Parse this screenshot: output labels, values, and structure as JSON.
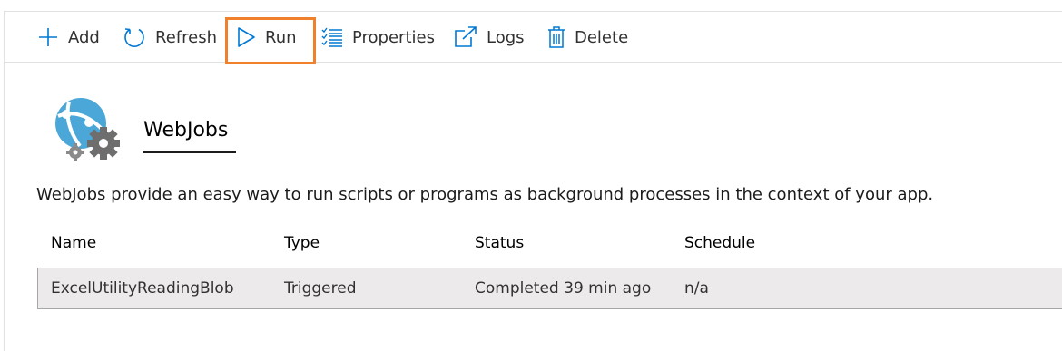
{
  "toolbar": {
    "add_label": "Add",
    "refresh_label": "Refresh",
    "run_label": "Run",
    "properties_label": "Properties",
    "logs_label": "Logs",
    "delete_label": "Delete"
  },
  "icons": {
    "add": "plus-icon",
    "refresh": "refresh-icon",
    "run": "play-icon",
    "properties": "list-icon",
    "logs": "external-link-icon",
    "delete": "trash-icon",
    "logo": "webjobs-logo-icon"
  },
  "colors": {
    "accent": "#0078d4",
    "highlight": "#f0802b",
    "row_background": "#eceaea"
  },
  "header": {
    "title": "WebJobs",
    "description": "WebJobs provide an easy way to run scripts or programs as background processes in the context of your app."
  },
  "table": {
    "columns": [
      "Name",
      "Type",
      "Status",
      "Schedule"
    ],
    "rows": [
      [
        "ExcelUtilityReadingBlob",
        "Triggered",
        "Completed 39 min ago",
        "n/a"
      ]
    ]
  }
}
